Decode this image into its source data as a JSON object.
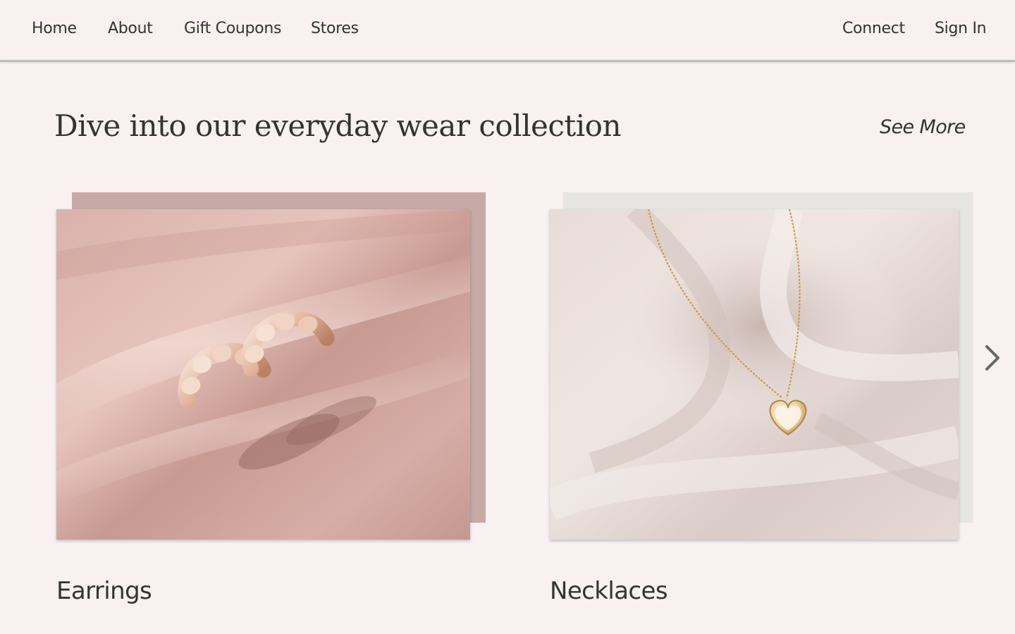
{
  "nav": {
    "left_links": [
      "Home",
      "About",
      "Gift Coupons",
      "Stores"
    ],
    "right_links": [
      "Connect",
      "Sign In"
    ]
  },
  "section": {
    "title": "Dive into our everyday wear collection",
    "see_more": "See More"
  },
  "cards": [
    {
      "label": "Earrings",
      "image": "gold hoop earrings on pink satin",
      "backdrop_color": "#c5aaa6"
    },
    {
      "label": "Necklaces",
      "image": "gold heart pendant necklace on ivory satin",
      "backdrop_color": "#e7e6e2"
    }
  ],
  "icons": {
    "carousel_next": "chevron-right-icon"
  },
  "colors": {
    "page_background": "#f8f0f1",
    "text": "#333333",
    "nav_border": "#bdbdbd"
  }
}
